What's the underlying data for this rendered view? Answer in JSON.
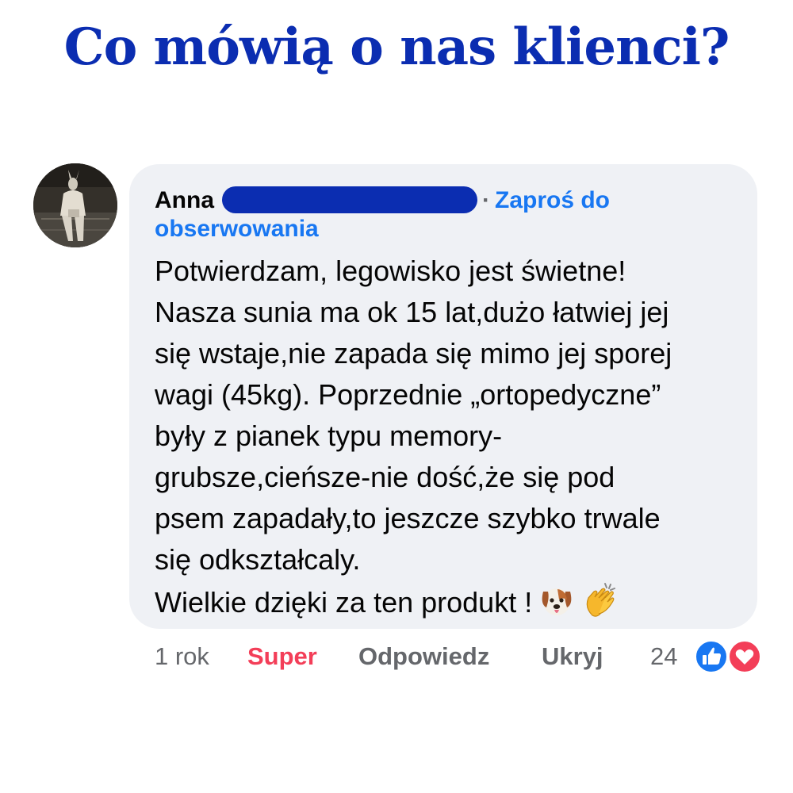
{
  "header": {
    "title": "Co mówią o nas klienci?"
  },
  "comment": {
    "author": "Anna",
    "separator": "·",
    "follow_action": "Zaproś do obserwowania",
    "follow_line1": "Zaproś do",
    "follow_line2": "obserwowania",
    "text_lines": [
      "Potwierdzam, legowisko jest świetne!",
      "Nasza sunia ma ok 15 lat,dużo łatwiej jej",
      "się wstaje,nie zapada się mimo jej sporej",
      "wagi (45kg). Poprzednie „ortopedyczne”",
      "były z pianek typu memory-",
      "grubsze,cieńsze-nie dość,że się pod",
      "psem zapadały,to jeszcze szybko trwale",
      "się odkształcaly.",
      "Wielkie dzięki za ten produkt !"
    ],
    "emojis": [
      "dog-face-emoji",
      "clapping-hands-emoji"
    ]
  },
  "actions": {
    "time": "1 rok",
    "reaction": "Super",
    "reply": "Odpowiedz",
    "hide": "Ukryj",
    "reaction_count": "24",
    "reaction_types": [
      "like-icon",
      "love-icon"
    ]
  },
  "colors": {
    "headline": "#0b2db1",
    "redaction": "#0b2db1",
    "link": "#1877f2",
    "reaction_active": "#f33e58",
    "bubble": "#eff1f5",
    "muted": "#65676b"
  }
}
